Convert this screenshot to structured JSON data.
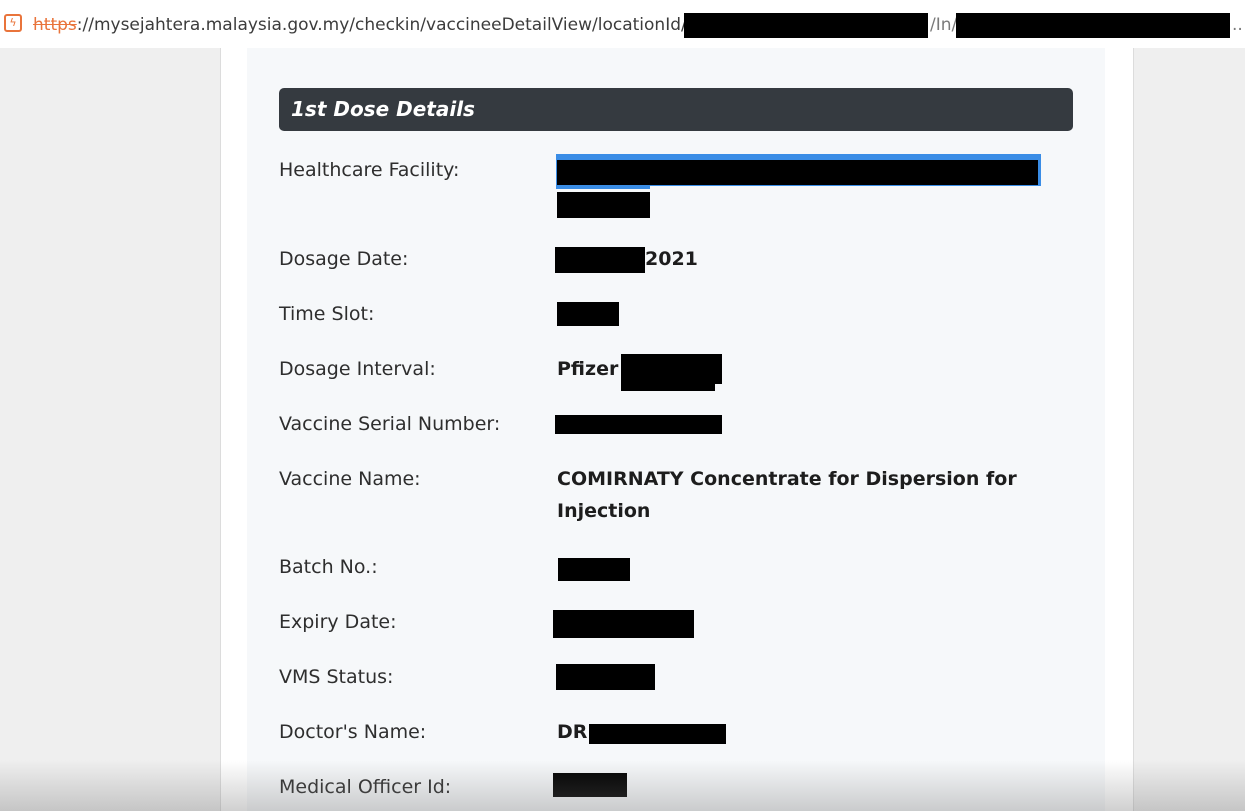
{
  "browser": {
    "url_scheme": "https",
    "url_separator": "://",
    "url_host": "mysejahtera.malaysia.gov.my",
    "url_path": "/checkin/vaccineeDetailView/locationId/",
    "url_mid": "/In/",
    "url_ellipsis": ".."
  },
  "card": {
    "title": "1st Dose Details"
  },
  "fields": {
    "healthcare_facility_label": "Healthcare Facility:",
    "dosage_date_label": "Dosage Date:",
    "dosage_date_value": "2021",
    "time_slot_label": "Time Slot:",
    "dosage_interval_label": "Dosage Interval:",
    "dosage_interval_value": "Pfizer",
    "vaccine_serial_label": "Vaccine Serial Number:",
    "vaccine_name_label": "Vaccine Name:",
    "vaccine_name_line1": "COMIRNATY Concentrate for Dispersion for",
    "vaccine_name_line2": "Injection",
    "batch_no_label": "Batch No.:",
    "expiry_date_label": "Expiry Date:",
    "vms_status_label": "VMS Status:",
    "doctor_name_label": "Doctor's Name:",
    "doctor_name_value": "DR",
    "medical_officer_label": "Medical Officer Id:"
  },
  "colors": {
    "header_bg": "#353a40",
    "url_scheme": "#e9743b",
    "selection": "#3a8de6"
  }
}
